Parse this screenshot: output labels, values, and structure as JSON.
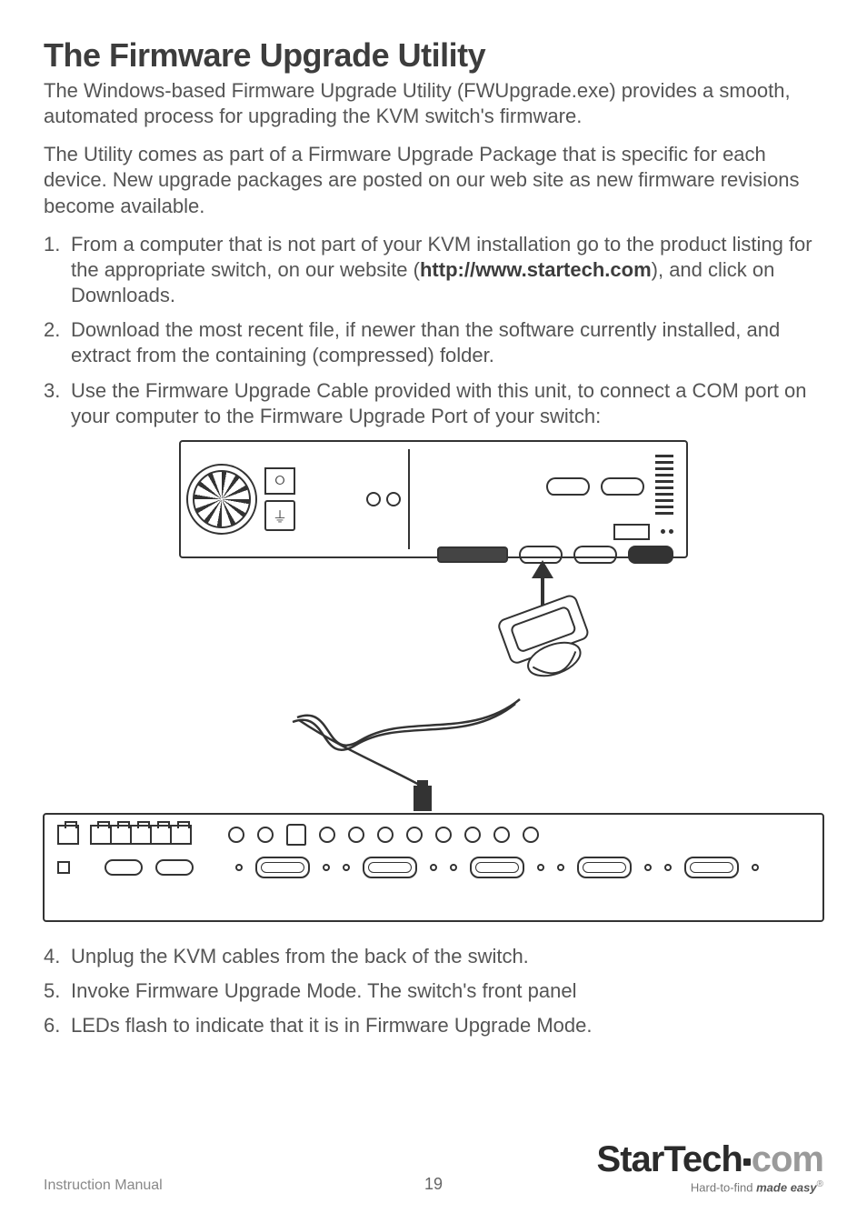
{
  "heading": "The Firmware Upgrade Utility",
  "intro1": "The Windows-based Firmware Upgrade Utility (FWUpgrade.exe) provides a smooth, automated process for upgrading the KVM switch's firmware.",
  "intro2": "The Utility comes as part of a Firmware Upgrade Package that is specific for each device. New upgrade packages are posted on our web site as new firmware revisions become available.",
  "steps": [
    {
      "num": "1.",
      "pre": "From a computer that is not part of your KVM installation go to the product listing for the appropriate switch, on our website (",
      "bold": "http://www.startech.com",
      "post": "), and click on Downloads."
    },
    {
      "num": "2.",
      "pre": "Download the most recent file, if newer than the software currently installed, and extract from the containing (compressed) folder.",
      "bold": "",
      "post": ""
    },
    {
      "num": "3.",
      "pre": "Use the Firmware Upgrade Cable provided with this unit, to connect a COM port on your computer to the Firmware Upgrade Port of your switch:",
      "bold": "",
      "post": ""
    }
  ],
  "steps2": [
    {
      "num": "4.",
      "text": "Unplug the KVM cables from the back of the switch."
    },
    {
      "num": "5.",
      "text": "Invoke Firmware Upgrade Mode. The switch's front panel"
    },
    {
      "num": "6.",
      "text": "LEDs flash to indicate that it is in Firmware Upgrade Mode."
    }
  ],
  "footer": {
    "left": "Instruction Manual",
    "page": "19",
    "logo_main1": "StarTech",
    "logo_main2": "com",
    "tagline_pre": "Hard-to-find ",
    "tagline_bold": "made easy",
    "reg": "®"
  }
}
